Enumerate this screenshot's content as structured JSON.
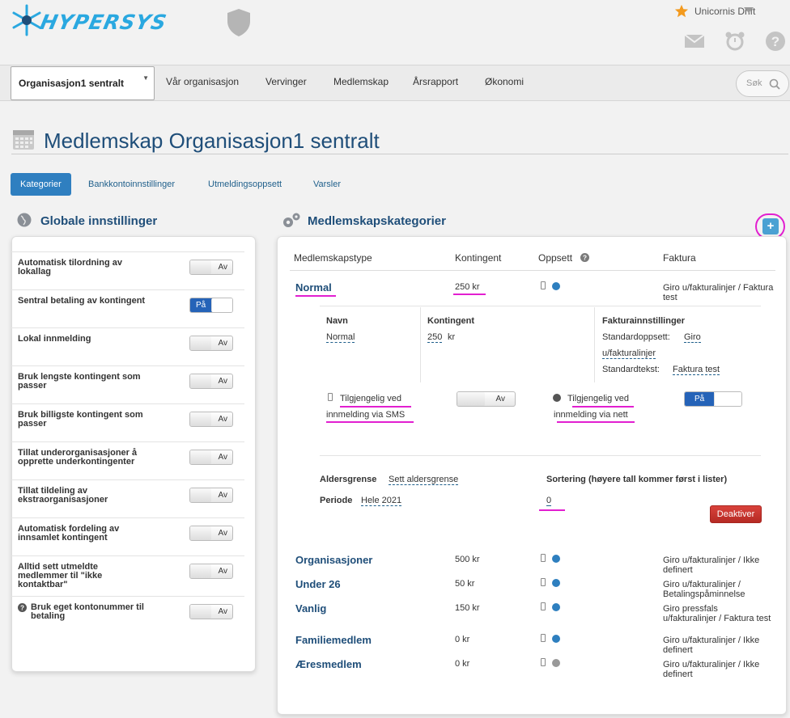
{
  "header": {
    "logo_text": "HYPERSYS",
    "user_name": "Unicornis Drift"
  },
  "nav": {
    "org_select": "Organisasjon1 sentralt",
    "links": [
      "Vår organisasjon",
      "Vervinger",
      "Medlemskap",
      "Årsrapport",
      "Økonomi"
    ],
    "search_placeholder": "Søk"
  },
  "page": {
    "title": "Medlemskap Organisasjon1 sentralt"
  },
  "tabs": [
    "Kategorier",
    "Bankkontoinnstillinger",
    "Utmeldingsoppsett",
    "Varsler"
  ],
  "global": {
    "heading": "Globale innstillinger",
    "settings": [
      {
        "label": "Automatisk tilordning av lokallag",
        "state": "Av"
      },
      {
        "label": "Sentral betaling av kontingent",
        "state": "På"
      },
      {
        "label": "Lokal innmelding",
        "state": "Av"
      },
      {
        "label": "Bruk lengste kontingent som passer",
        "state": "Av"
      },
      {
        "label": "Bruk billigste kontingent som passer",
        "state": "Av"
      },
      {
        "label": "Tillat underorganisasjoner å opprette underkontingenter",
        "state": "Av"
      },
      {
        "label": "Tillat tildeling av ekstraorganisasjoner",
        "state": "Av"
      },
      {
        "label": "Automatisk fordeling av innsamlet kontingent",
        "state": "Av"
      },
      {
        "label": "Alltid sett utmeldte medlemmer til \"ikke kontaktbar\"",
        "state": "Av"
      },
      {
        "label": "Bruk eget kontonummer til betaling",
        "state": "Av"
      }
    ]
  },
  "categories": {
    "heading": "Medlemskapskategorier",
    "add_label": "+",
    "columns": [
      "Medlemskapstype",
      "Kontingent",
      "Oppsett",
      "Faktura"
    ],
    "rows": [
      {
        "name": "Normal",
        "fee": "250 kr",
        "invoice": "Giro u/fakturalinjer / Faktura test",
        "web_enabled": true
      },
      {
        "name": "Organisasjoner",
        "fee": "500 kr",
        "invoice": "Giro u/fakturalinjer / Ikke definert",
        "web_enabled": true
      },
      {
        "name": "Under 26",
        "fee": "50 kr",
        "invoice": "Giro u/fakturalinjer / Betalingspåminnelse",
        "web_enabled": true
      },
      {
        "name": "Vanlig",
        "fee": "150 kr",
        "invoice": "Giro pressfals u/fakturalinjer / Faktura test",
        "web_enabled": true
      },
      {
        "name": "Familiemedlem",
        "fee": "0 kr",
        "invoice": "Giro u/fakturalinjer / Ikke definert",
        "web_enabled": true
      },
      {
        "name": "Æresmedlem",
        "fee": "0 kr",
        "invoice": "Giro u/fakturalinjer / Ikke definert",
        "web_enabled": false
      }
    ],
    "detail": {
      "navn_label": "Navn",
      "navn_value": "Normal",
      "kontingent_label": "Kontingent",
      "kontingent_value": "250",
      "kontingent_unit": "kr",
      "faktura_label": "Fakturainnstillinger",
      "standardoppsett_label": "Standardoppsett:",
      "standardoppsett_value_1": "Giro",
      "standardoppsett_value_2": "u/fakturalinjer",
      "standardtekst_label": "Standardtekst:",
      "standardtekst_value": "Faktura test",
      "sms_label_1": "Tilgjengelig ved",
      "sms_label_2": "innmelding via SMS",
      "sms_state": "Av",
      "web_label_1": "Tilgjengelig ved",
      "web_label_2": "innmelding via nett",
      "web_state": "På",
      "aldersgrense_label": "Aldersgrense",
      "aldersgrense_value": "Sett aldersgrense",
      "periode_label": "Periode",
      "periode_value": "Hele 2021",
      "sortering_label": "Sortering (høyere tall kommer først i lister)",
      "sortering_value": "0",
      "deactivate_label": "Deaktiver"
    }
  },
  "colors": {
    "primary_blue": "#2f7fc0",
    "title_blue": "#1f4e79",
    "toggle_on": "#2563b8",
    "danger": "#c8302a",
    "highlight": "#e21fd0"
  }
}
